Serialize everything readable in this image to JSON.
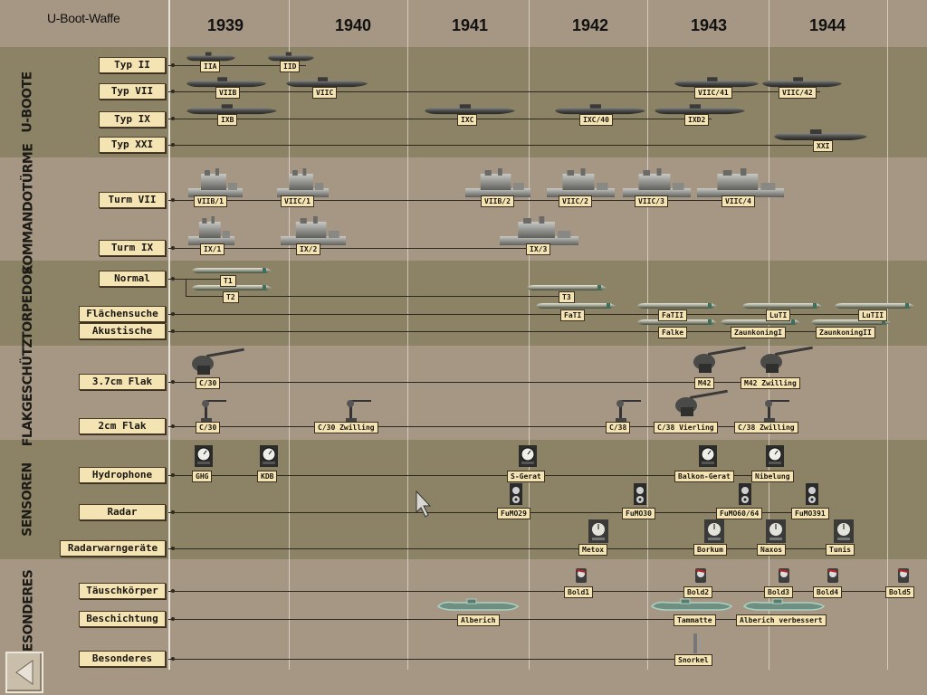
{
  "app": {
    "title": "U-Boot-Waffe"
  },
  "years": [
    "1939",
    "1940",
    "1941",
    "1942",
    "1943",
    "1944"
  ],
  "sections": [
    {
      "title": "U-BOOTE",
      "lanes": [
        {
          "label": "Typ II",
          "items": [
            "IIA",
            "IID"
          ]
        },
        {
          "label": "Typ VII",
          "items": [
            "VIIB",
            "VIIC",
            "VIIC/41",
            "VIIC/42"
          ]
        },
        {
          "label": "Typ IX",
          "items": [
            "IXB",
            "IXC",
            "IXC/40",
            "IXD2"
          ]
        },
        {
          "label": "Typ XXI",
          "items": [
            "XXI"
          ]
        }
      ]
    },
    {
      "title": "KOMMANDOTÜRME",
      "lanes": [
        {
          "label": "Turm VII",
          "items": [
            "VIIB/1",
            "VIIC/1",
            "VIIB/2",
            "VIIC/2",
            "VIIC/3",
            "VIIC/4"
          ]
        },
        {
          "label": "Turm IX",
          "items": [
            "IX/1",
            "IX/2",
            "IX/3"
          ]
        }
      ]
    },
    {
      "title": "TORPEDOS",
      "lanes": [
        {
          "label": "Normal",
          "items": [
            "T1",
            "T2",
            "T3"
          ]
        },
        {
          "label": "Flächensuche",
          "items": [
            "FaTI",
            "FaTII",
            "LuTI",
            "LuTII"
          ]
        },
        {
          "label": "Akustische",
          "items": [
            "Falke",
            "ZaunkoningI",
            "ZaunkoningII"
          ]
        }
      ]
    },
    {
      "title": "FLAKGESCHÜTZ",
      "lanes": [
        {
          "label": "3.7cm Flak",
          "items": [
            "C/30",
            "M42",
            "M42 Zwilling"
          ]
        },
        {
          "label": "2cm Flak",
          "items": [
            "C/30",
            "C/30 Zwilling",
            "C/38",
            "C/38 Vierling",
            "C/38 Zwilling"
          ]
        }
      ]
    },
    {
      "title": "SENSOREN",
      "lanes": [
        {
          "label": "Hydrophone",
          "items": [
            "GHG",
            "KDB",
            "S-Gerat",
            "Balkon-Gerat",
            "Nibelung"
          ]
        },
        {
          "label": "Radar",
          "items": [
            "FuMO29",
            "FuMO30",
            "FuMO60/64",
            "FuMO391"
          ]
        },
        {
          "label": "Radarwarngeräte",
          "items": [
            "Metox",
            "Borkum",
            "Naxos",
            "Tunis"
          ]
        }
      ]
    },
    {
      "title": "BESONDERES",
      "lanes": [
        {
          "label": "Täuschkörper",
          "items": [
            "Bold1",
            "Bold2",
            "Bold3",
            "Bold4",
            "Bold5"
          ]
        },
        {
          "label": "Beschichtung",
          "items": [
            "Alberich",
            "Tammatte",
            "Alberich verbessert"
          ]
        },
        {
          "label": "Besonderes",
          "items": [
            "Snorkel"
          ]
        }
      ]
    }
  ],
  "icons": {
    "submarine": "submarine-icon",
    "tower": "conning-tower-icon",
    "torpedo": "torpedo-icon",
    "flak": "flak-gun-icon",
    "hydrophone": "hydrophone-gauge-icon",
    "radar": "radar-speaker-icon",
    "warning": "radar-warning-dial-icon",
    "decoy": "decoy-canister-icon",
    "coating": "coated-hull-icon",
    "snorkel": "snorkel-mast-icon",
    "back": "back-arrow-icon",
    "cursor": "mouse-cursor-icon"
  },
  "colors": {
    "dark_band": "#8c8366",
    "light_band": "#a69784",
    "tag": "#f5e4b3"
  }
}
